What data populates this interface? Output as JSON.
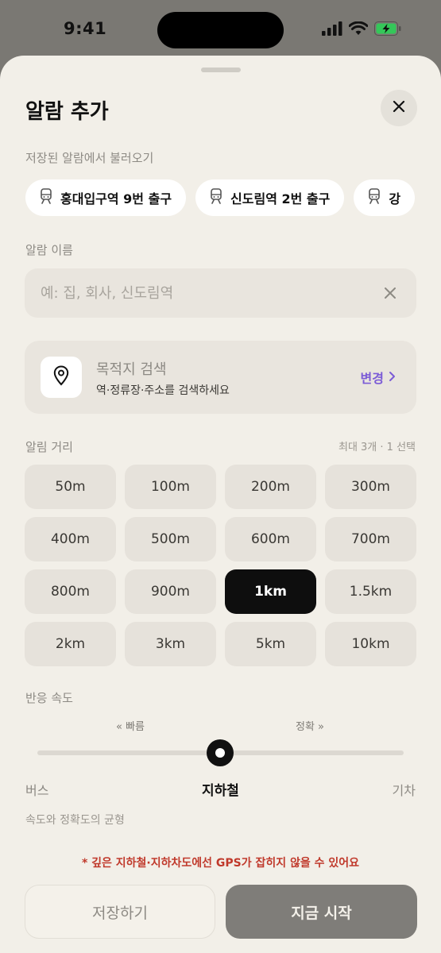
{
  "status_bar": {
    "time": "9:41"
  },
  "sheet": {
    "title": "알람 추가",
    "saved_section": {
      "label": "저장된 알람에서 불러오기",
      "items": [
        {
          "label": "홍대입구역 9번 출구",
          "icon": "train-icon"
        },
        {
          "label": "신도림역 2번 출구",
          "icon": "train-icon"
        },
        {
          "label": "강",
          "icon": "train-icon"
        }
      ]
    },
    "name_section": {
      "label": "알람 이름",
      "value": "",
      "placeholder": "예: 집, 회사, 신도림역"
    },
    "destination": {
      "title": "목적지 검색",
      "subtitle": "역·정류장·주소를 검색하세요",
      "action": "변경",
      "icon": "map-pin-icon"
    },
    "distance_section": {
      "label": "알림 거리",
      "limit": "최대 3개 · 1 선택",
      "options": [
        "50m",
        "100m",
        "200m",
        "300m",
        "400m",
        "500m",
        "600m",
        "700m",
        "800m",
        "900m",
        "1km",
        "1.5km",
        "2km",
        "3km",
        "5km",
        "10km"
      ],
      "selected": "1km"
    },
    "speed_section": {
      "label": "반응 속도",
      "hint_fast": "« 빠름",
      "hint_accurate": "정확 »",
      "level": 0.5,
      "modes": [
        "버스",
        "지하철",
        "기차"
      ],
      "selected_mode": "지하철",
      "description": "속도와 정확도의 균형"
    },
    "warning": "* 깊은 지하철·지하차도에선 GPS가 잡히지 않을 수 있어요",
    "buttons": {
      "save": "저장하기",
      "start": "지금 시작"
    }
  },
  "colors": {
    "accent": "#7b5bd6",
    "warning": "#c0392b",
    "selected": "#0e0e0e",
    "battery": "#34c759"
  }
}
